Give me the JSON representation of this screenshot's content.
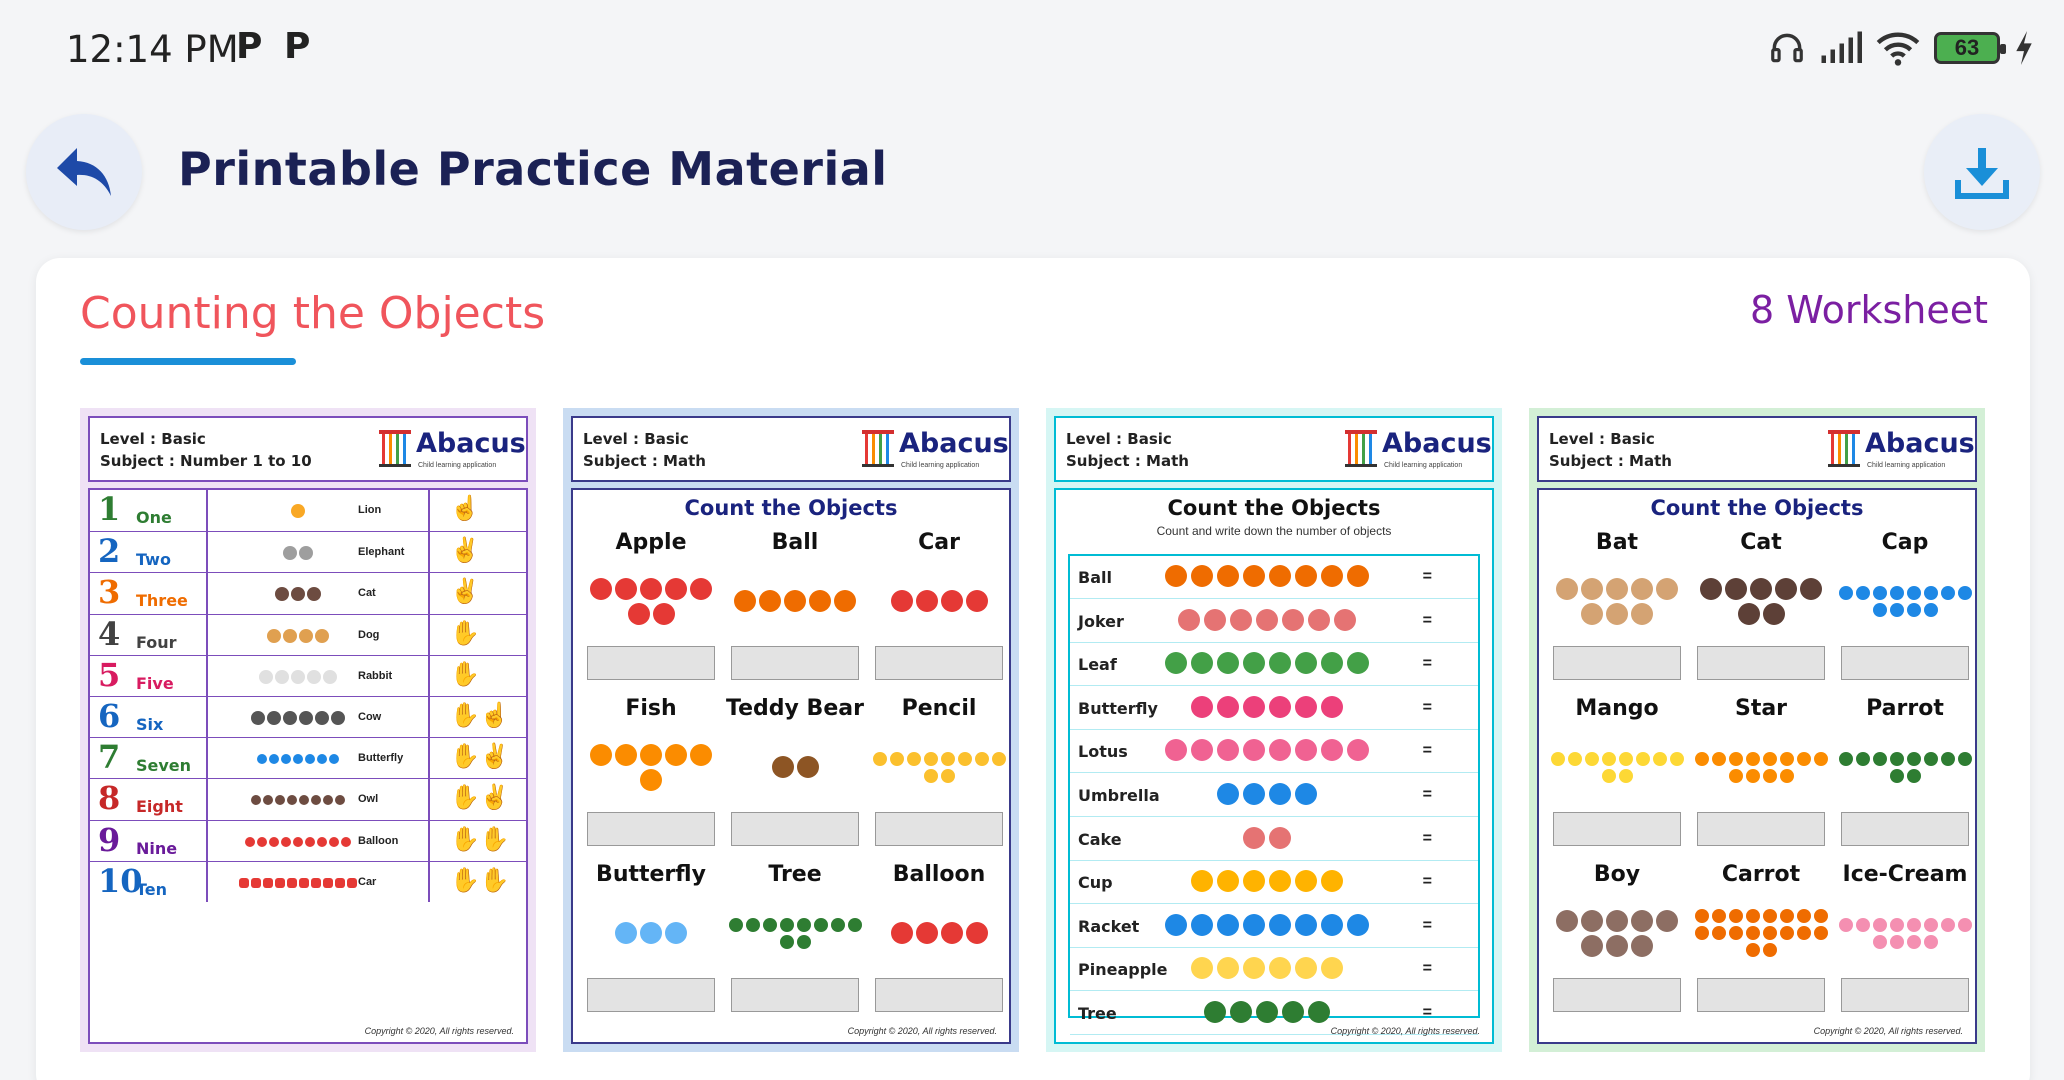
{
  "status_bar": {
    "time": "12:14 PM",
    "p1": "P",
    "p2": "P",
    "battery": "63"
  },
  "header": {
    "title": "Printable Practice Material"
  },
  "section": {
    "title": "Counting the Objects",
    "count_label": "8 Worksheet"
  },
  "colors": {
    "title": "#1b2155",
    "section_title": "#f0555c",
    "underline": "#1a8fd8",
    "count": "#7b1fa2"
  },
  "logo": {
    "name": "Abacus",
    "tagline": "Child learning application"
  },
  "copyright": "Copyright © 2020, All rights reserved.",
  "sheets": [
    {
      "level": "Level : Basic",
      "subject": "Subject : Number 1 to 10",
      "rows": [
        {
          "digit": "1",
          "word": "One",
          "object": "Lion"
        },
        {
          "digit": "2",
          "word": "Two",
          "object": "Elephant"
        },
        {
          "digit": "3",
          "word": "Three",
          "object": "Cat"
        },
        {
          "digit": "4",
          "word": "Four",
          "object": "Dog"
        },
        {
          "digit": "5",
          "word": "Five",
          "object": "Rabbit"
        },
        {
          "digit": "6",
          "word": "Six",
          "object": "Cow"
        },
        {
          "digit": "7",
          "word": "Seven",
          "object": "Butterfly"
        },
        {
          "digit": "8",
          "word": "Eight",
          "object": "Owl"
        },
        {
          "digit": "9",
          "word": "Nine",
          "object": "Balloon"
        },
        {
          "digit": "10",
          "word": "Ten",
          "object": "Car"
        }
      ]
    },
    {
      "level": "Level : Basic",
      "subject": "Subject : Math",
      "title": "Count the Objects",
      "items": [
        "Apple",
        "Ball",
        "Car",
        "Fish",
        "Teddy Bear",
        "Pencil",
        "Butterfly",
        "Tree",
        "Balloon"
      ]
    },
    {
      "level": "Level : Basic",
      "subject": "Subject : Math",
      "title": "Count the Objects",
      "subtitle": "Count and write down the number of objects",
      "rows": [
        "Ball",
        "Joker",
        "Leaf",
        "Butterfly",
        "Lotus",
        "Umbrella",
        "Cake",
        "Cup",
        "Racket",
        "Pineapple",
        "Tree"
      ],
      "equals": "="
    },
    {
      "level": "Level : Basic",
      "subject": "Subject : Math",
      "title": "Count the Objects",
      "items": [
        "Bat",
        "Cat",
        "Cap",
        "Mango",
        "Star",
        "Parrot",
        "Boy",
        "Carrot",
        "Ice-Cream"
      ]
    }
  ]
}
